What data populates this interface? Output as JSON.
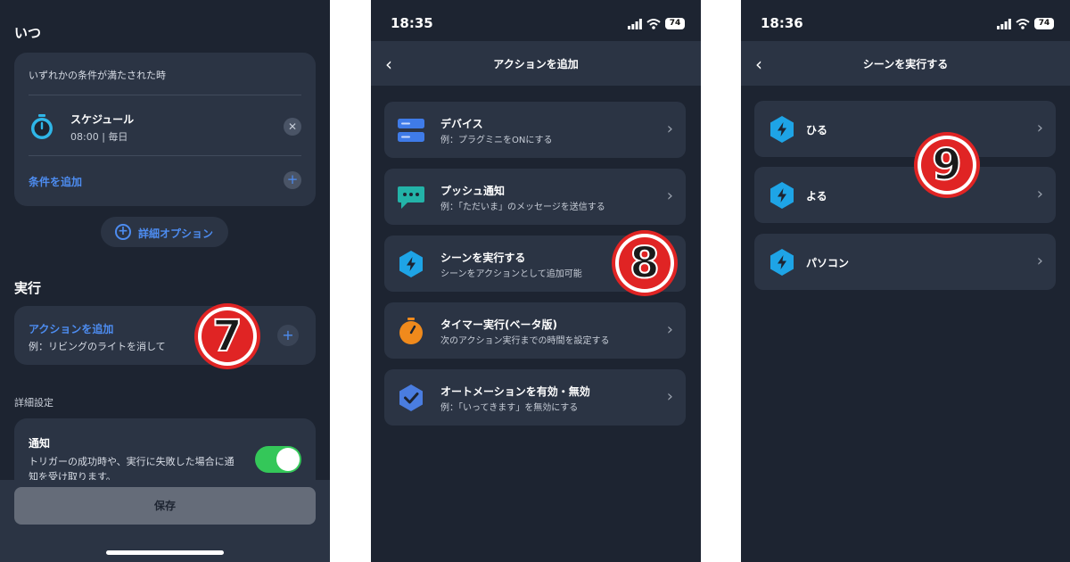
{
  "panel1": {
    "when_title": "いつ",
    "condition_card": {
      "mode_text": "いずれかの条件が満たされた時",
      "schedule_title": "スケジュール",
      "schedule_sub": "08:00 | 毎日",
      "add_condition": "条件を追加"
    },
    "detail_options": "詳細オプション",
    "exec_title": "実行",
    "add_action": {
      "title": "アクションを追加",
      "sub": "例：リビングのライトを消して"
    },
    "advanced_label": "詳細設定",
    "notification": {
      "title": "通知",
      "desc_line1": "トリガーの成功時や、実行に失敗した場合に通",
      "desc_line2": "知を受け取ります。",
      "enabled": true
    },
    "save_button": "保存",
    "badge": "7"
  },
  "panel2": {
    "status_time": "18:35",
    "battery": "74",
    "nav_title": "アクションを追加",
    "rows": [
      {
        "title": "デバイス",
        "sub": "例：プラグミニをONにする",
        "icon": "device-icon"
      },
      {
        "title": "プッシュ通知",
        "sub": "例：「ただいま」のメッセージを送信する",
        "icon": "chat-bubble-icon"
      },
      {
        "title": "シーンを実行する",
        "sub": "シーンをアクションとして追加可能",
        "icon": "scene-bolt-icon"
      },
      {
        "title": "タイマー実行(ベータ版)",
        "sub": "次のアクション実行までの時間を設定する",
        "icon": "timer-icon"
      },
      {
        "title": "オートメーションを有効・無効",
        "sub": "例：「いってきます」を無効にする",
        "icon": "check-shield-icon"
      }
    ],
    "badge": "8"
  },
  "panel3": {
    "status_time": "18:36",
    "battery": "74",
    "nav_title": "シーンを実行する",
    "scenes": [
      "ひる",
      "よる",
      "パソコン"
    ],
    "badge": "9"
  },
  "colors": {
    "background": "#1d2431",
    "card": "#2b3444",
    "accent_blue": "#4d8cf0",
    "toggle_green": "#34c759",
    "badge_red": "#e02424",
    "timer_cyan": "#2fb6e8",
    "timer_orange": "#f08a1c"
  }
}
